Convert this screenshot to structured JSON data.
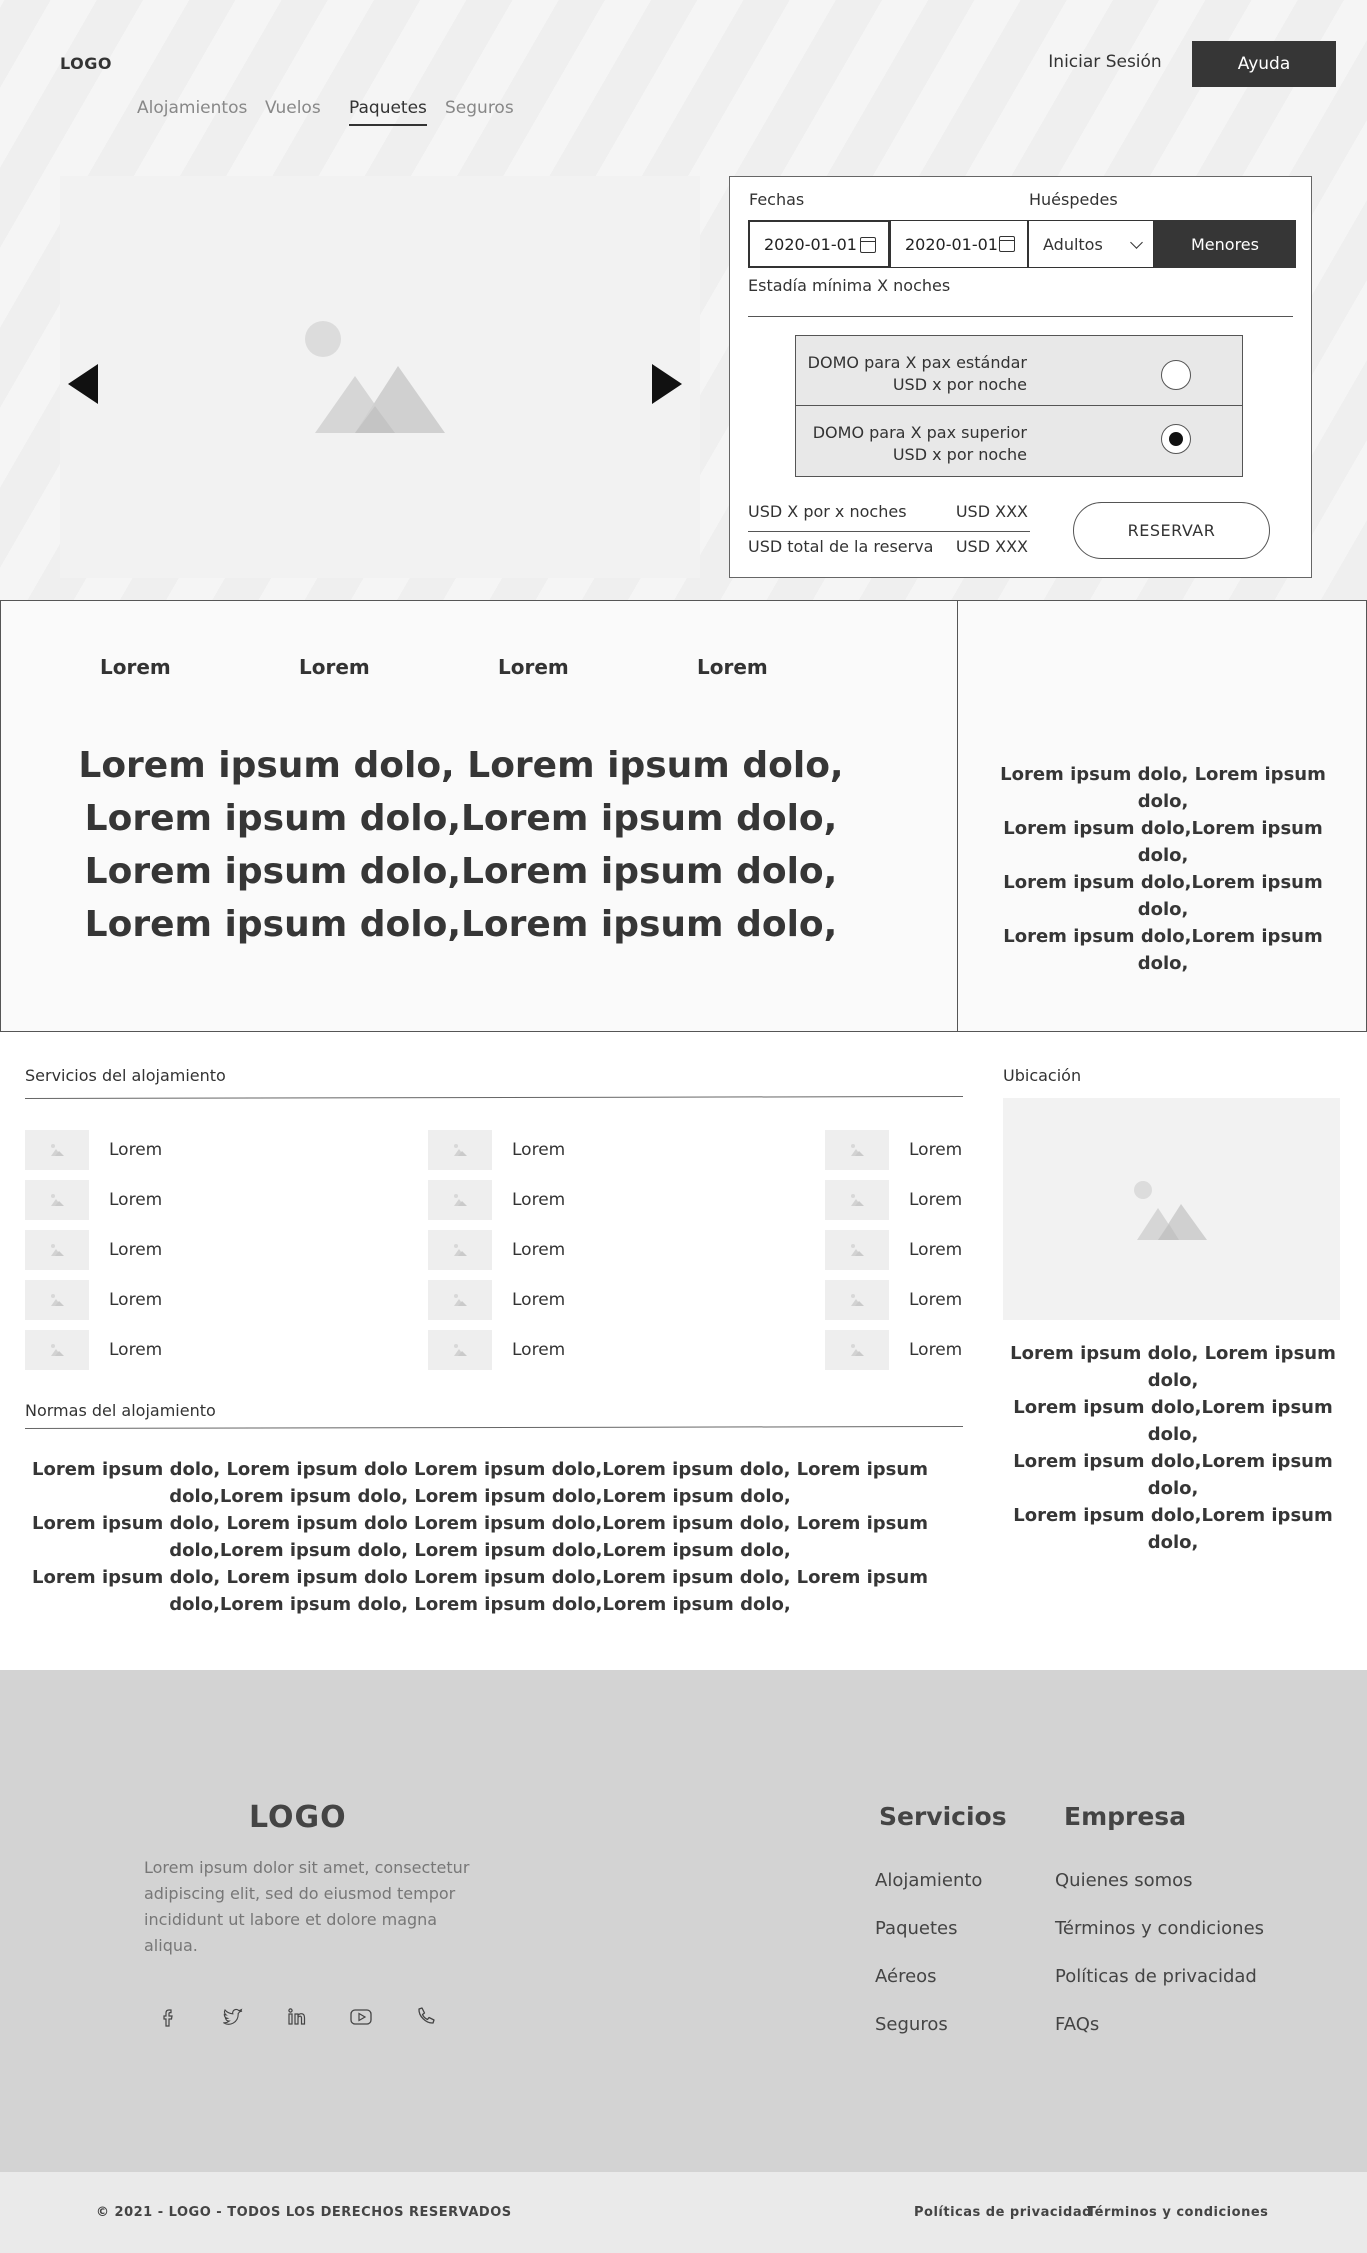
{
  "header": {
    "logo": "LOGO",
    "login_label": "Iniciar Sesión",
    "help_label": "Ayuda",
    "nav": [
      "Alojamientos",
      "Vuelos",
      "Paquetes",
      "Seguros"
    ],
    "active_nav": "Paquetes"
  },
  "booking": {
    "dates_label": "Fechas",
    "guests_label": "Huéspedes",
    "date_from": "2020-01-01",
    "date_to": "2020-01-01",
    "adults_label": "Adultos",
    "minors_label": "Menores",
    "min_stay": "Estadía mínima X noches",
    "rooms": [
      {
        "line1": "DOMO para X pax estándar",
        "line2": "USD x por noche",
        "selected": false
      },
      {
        "line1": "DOMO para X pax superior",
        "line2": "USD x por noche",
        "selected": true
      }
    ],
    "per_nights_label": "USD X por x noches",
    "per_nights_value": "USD XXX",
    "total_label": "USD total de la reserva",
    "total_value": "USD XXX",
    "reserve_label": "RESERVAR"
  },
  "info": {
    "tabs": [
      "Lorem",
      "Lorem",
      "Lorem",
      "Lorem"
    ],
    "big_text": [
      "Lorem ipsum dolo, Lorem ipsum dolo,",
      "Lorem ipsum dolo,Lorem ipsum dolo,",
      "Lorem ipsum dolo,Lorem ipsum dolo,",
      "Lorem ipsum dolo,Lorem ipsum dolo,"
    ],
    "side_text": [
      "Lorem ipsum dolo, Lorem ipsum dolo,",
      "Lorem ipsum dolo,Lorem ipsum dolo,",
      "Lorem ipsum dolo,Lorem ipsum dolo,",
      "Lorem ipsum dolo,Lorem ipsum dolo,"
    ]
  },
  "services": {
    "title": "Servicios del alojamiento",
    "columns": [
      [
        "Lorem",
        "Lorem",
        "Lorem",
        "Lorem",
        "Lorem"
      ],
      [
        "Lorem",
        "Lorem",
        "Lorem",
        "Lorem",
        "Lorem"
      ],
      [
        "Lorem",
        "Lorem",
        "Lorem",
        "Lorem",
        "Lorem"
      ]
    ]
  },
  "location": {
    "title": "Ubicación",
    "text": [
      "Lorem ipsum dolo, Lorem ipsum dolo,",
      "Lorem ipsum dolo,Lorem ipsum dolo,",
      "Lorem ipsum dolo,Lorem ipsum dolo,",
      "Lorem ipsum dolo,Lorem ipsum dolo,"
    ]
  },
  "rules": {
    "title": "Normas del alojamiento",
    "paragraphs": [
      "Lorem ipsum dolo, Lorem ipsum dolo Lorem ipsum dolo,Lorem ipsum dolo, Lorem ipsum dolo,Lorem ipsum dolo, Lorem ipsum dolo,Lorem ipsum dolo,",
      "Lorem ipsum dolo, Lorem ipsum dolo Lorem ipsum dolo,Lorem ipsum dolo, Lorem ipsum dolo,Lorem ipsum dolo, Lorem ipsum dolo,Lorem ipsum dolo,",
      "Lorem ipsum dolo, Lorem ipsum dolo Lorem ipsum dolo,Lorem ipsum dolo, Lorem ipsum dolo,Lorem ipsum dolo, Lorem ipsum dolo,Lorem ipsum dolo,"
    ]
  },
  "footer": {
    "logo": "LOGO",
    "description": "Lorem ipsum dolor sit amet, consectetur adipiscing elit, sed do eiusmod tempor incididunt ut labore et dolore magna aliqua.",
    "social_icons": [
      "facebook-icon",
      "twitter-icon",
      "linkedin-icon",
      "youtube-icon",
      "phone-icon"
    ],
    "services_title": "Servicios",
    "services_links": [
      "Alojamiento",
      "Paquetes",
      "Aéreos",
      "Seguros"
    ],
    "company_title": "Empresa",
    "company_links": [
      "Quienes somos",
      "Términos y condiciones",
      "Políticas de privacidad",
      "FAQs"
    ],
    "copyright": "© 2021 - LOGO - TODOS LOS DERECHOS RESERVADOS",
    "bottom_links": [
      "Políticas de privacidad",
      "Términos y condiciones"
    ]
  },
  "colors": {
    "dark": "#363636",
    "footer_bg": "#d3d3d3",
    "footer_bottom_bg": "#eaeaea",
    "placeholder": "#f2f2f2"
  }
}
